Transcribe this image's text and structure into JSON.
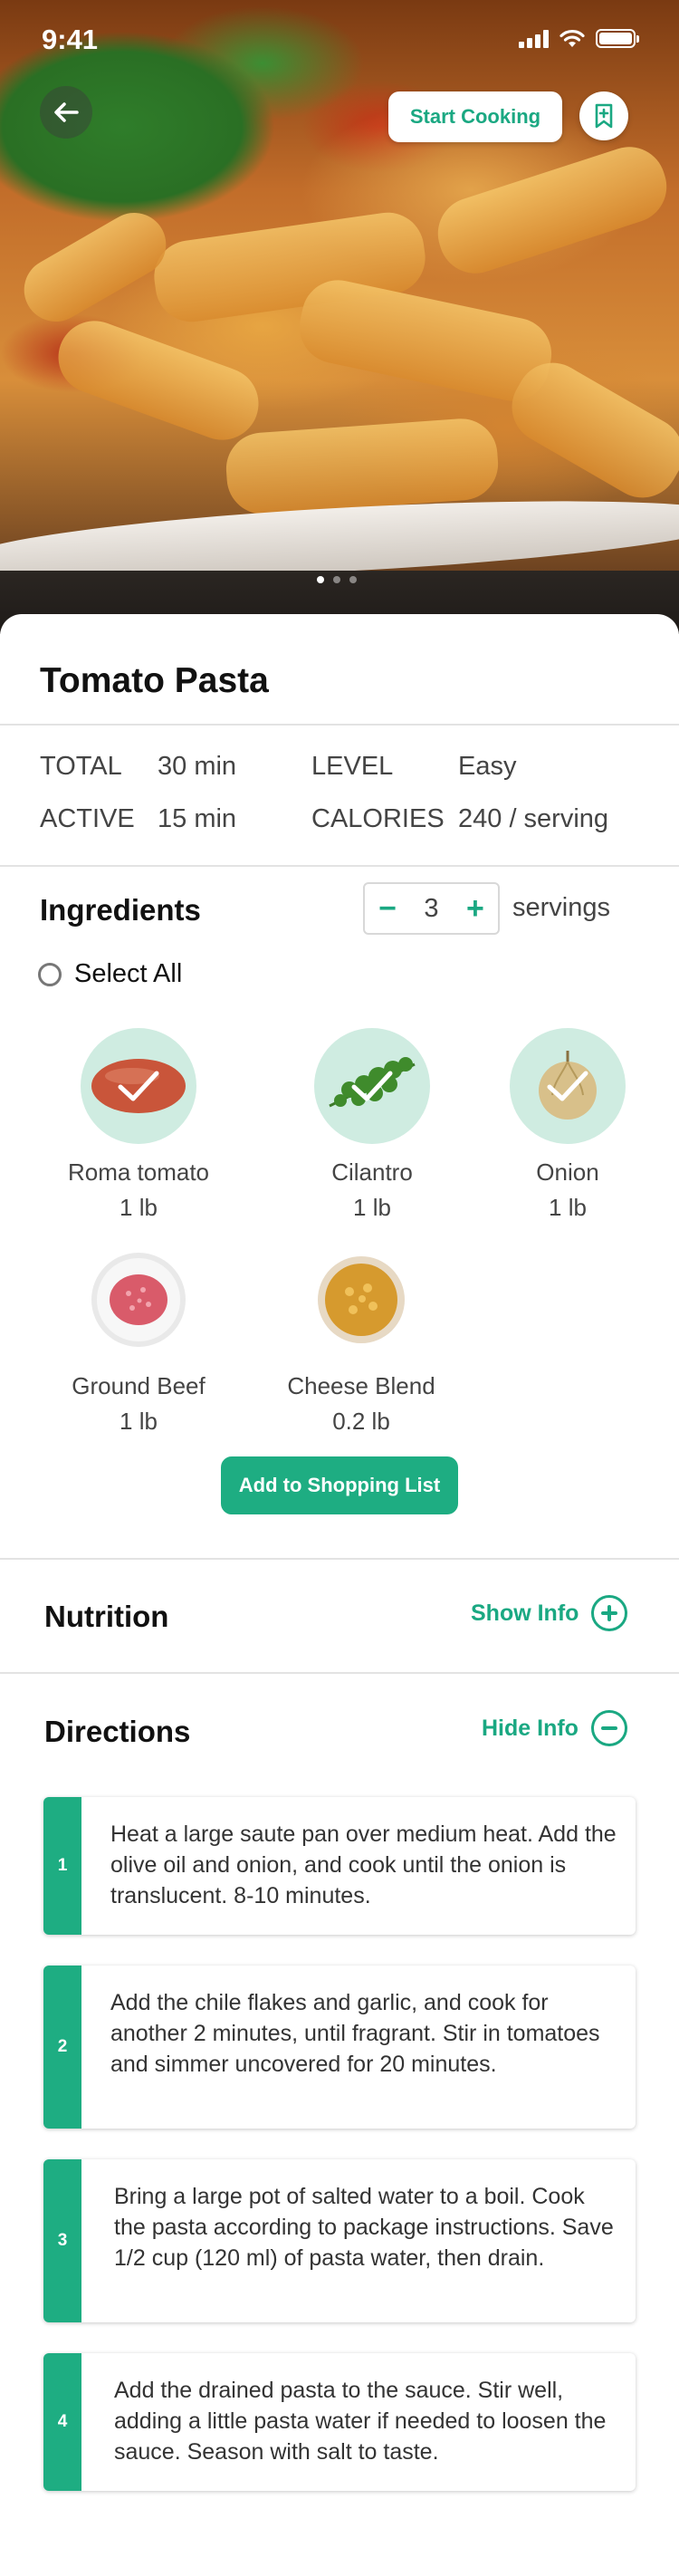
{
  "status_bar": {
    "time": "9:41"
  },
  "hero": {
    "start_cooking_label": "Start Cooking"
  },
  "recipe": {
    "title": "Tomato Pasta",
    "meta": {
      "total_label": "TOTAL",
      "total_value": "30 min",
      "level_label": "LEVEL",
      "level_value": "Easy",
      "active_label": "ACTIVE",
      "active_value": "15 min",
      "calories_label": "CALORIES",
      "calories_value": "240 / serving"
    }
  },
  "ingredients": {
    "heading": "Ingredients",
    "servings_count": "3",
    "servings_label": "servings",
    "select_all_label": "Select All",
    "items": [
      {
        "name": "Roma tomato",
        "qty": "1 lb",
        "selected": true
      },
      {
        "name": "Cilantro",
        "qty": "1 lb",
        "selected": true
      },
      {
        "name": "Onion",
        "qty": "1 lb",
        "selected": true
      },
      {
        "name": "Ground Beef",
        "qty": "1 lb",
        "selected": false
      },
      {
        "name": "Cheese Blend",
        "qty": "0.2 lb",
        "selected": false
      }
    ],
    "add_button_label": "Add to Shopping List"
  },
  "nutrition": {
    "heading": "Nutrition",
    "toggle_label": "Show Info"
  },
  "directions": {
    "heading": "Directions",
    "toggle_label": "Hide Info",
    "steps": [
      {
        "number": "1",
        "text": "Heat a large saute pan over medium heat. Add the olive oil and onion, and cook until the onion is translucent. 8-10 minutes."
      },
      {
        "number": "2",
        "text": "Add the chile flakes and garlic, and cook for another 2 minutes, until fragrant. Stir in tomatoes and simmer uncovered for 20 minutes."
      },
      {
        "number": "3",
        "text": "Bring a large pot of salted water to a boil. Cook the pasta according to package instructions. Save 1/2 cup (120 ml) of pasta water, then drain."
      },
      {
        "number": "4",
        "text": "Add the drained pasta to the sauce. Stir well, adding a little pasta water if needed to loosen the sauce. Season with salt to taste."
      }
    ]
  },
  "colors": {
    "accent": "#1ead82",
    "accent_light": "#cfece1"
  }
}
